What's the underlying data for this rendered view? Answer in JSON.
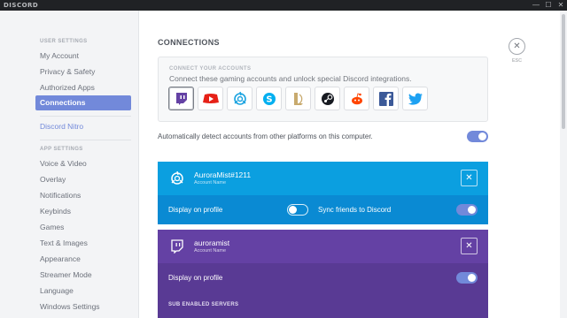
{
  "window": {
    "brand": "DISCORD",
    "controls": [
      "—",
      "☐",
      "✕"
    ]
  },
  "sidebar": {
    "user_settings_header": "USER SETTINGS",
    "user_items": [
      {
        "label": "My Account"
      },
      {
        "label": "Privacy & Safety"
      },
      {
        "label": "Authorized Apps"
      },
      {
        "label": "Connections"
      }
    ],
    "active_item": "Connections",
    "nitro": "Discord Nitro",
    "app_settings_header": "APP SETTINGS",
    "app_items": [
      {
        "label": "Voice & Video"
      },
      {
        "label": "Overlay"
      },
      {
        "label": "Notifications"
      },
      {
        "label": "Keybinds"
      },
      {
        "label": "Games"
      },
      {
        "label": "Text & Images"
      },
      {
        "label": "Appearance"
      },
      {
        "label": "Streamer Mode"
      },
      {
        "label": "Language"
      },
      {
        "label": "Windows Settings"
      }
    ]
  },
  "main": {
    "title": "CONNECTIONS",
    "close_label": "ESC",
    "connect_header": "CONNECT YOUR ACCOUNTS",
    "connect_description": "Connect these gaming accounts and unlock special Discord integrations.",
    "services": [
      {
        "name": "twitch-icon",
        "color": "#6441a4"
      },
      {
        "name": "youtube-icon",
        "color": "#e62117"
      },
      {
        "name": "battlenet-icon",
        "color": "#1aa3e0"
      },
      {
        "name": "skype-icon",
        "color": "#00aff0"
      },
      {
        "name": "league-of-legends-icon",
        "color": "#c8aa6e"
      },
      {
        "name": "steam-icon",
        "color": "#171a21"
      },
      {
        "name": "reddit-icon",
        "color": "#ff4500"
      },
      {
        "name": "facebook-icon",
        "color": "#3b5998"
      },
      {
        "name": "twitter-icon",
        "color": "#1da1f2"
      }
    ],
    "auto_detect": {
      "label": "Automatically detect accounts from other platforms on this computer.",
      "enabled": true
    },
    "connections": [
      {
        "service": "battlenet",
        "icon": "battlenet-icon",
        "name": "AuroraMist#1211",
        "sub": "Account Name",
        "display_label": "Display on profile",
        "display_enabled": false,
        "sync_label": "Sync friends to Discord",
        "sync_enabled": true,
        "header_color": "#0b9fe0",
        "body_color": "#0a8ad3"
      },
      {
        "service": "twitch",
        "icon": "twitch-icon",
        "name": "auroramist",
        "sub": "Account Name",
        "display_label": "Display on profile",
        "display_enabled": true,
        "sub_servers": "SUB ENABLED SERVERS",
        "header_color": "#6441a4",
        "body_color": "#593a94"
      }
    ]
  },
  "colors": {
    "accent": "#7289da",
    "sidebar_bg": "#f3f4f6",
    "titlebar": "#202225"
  }
}
